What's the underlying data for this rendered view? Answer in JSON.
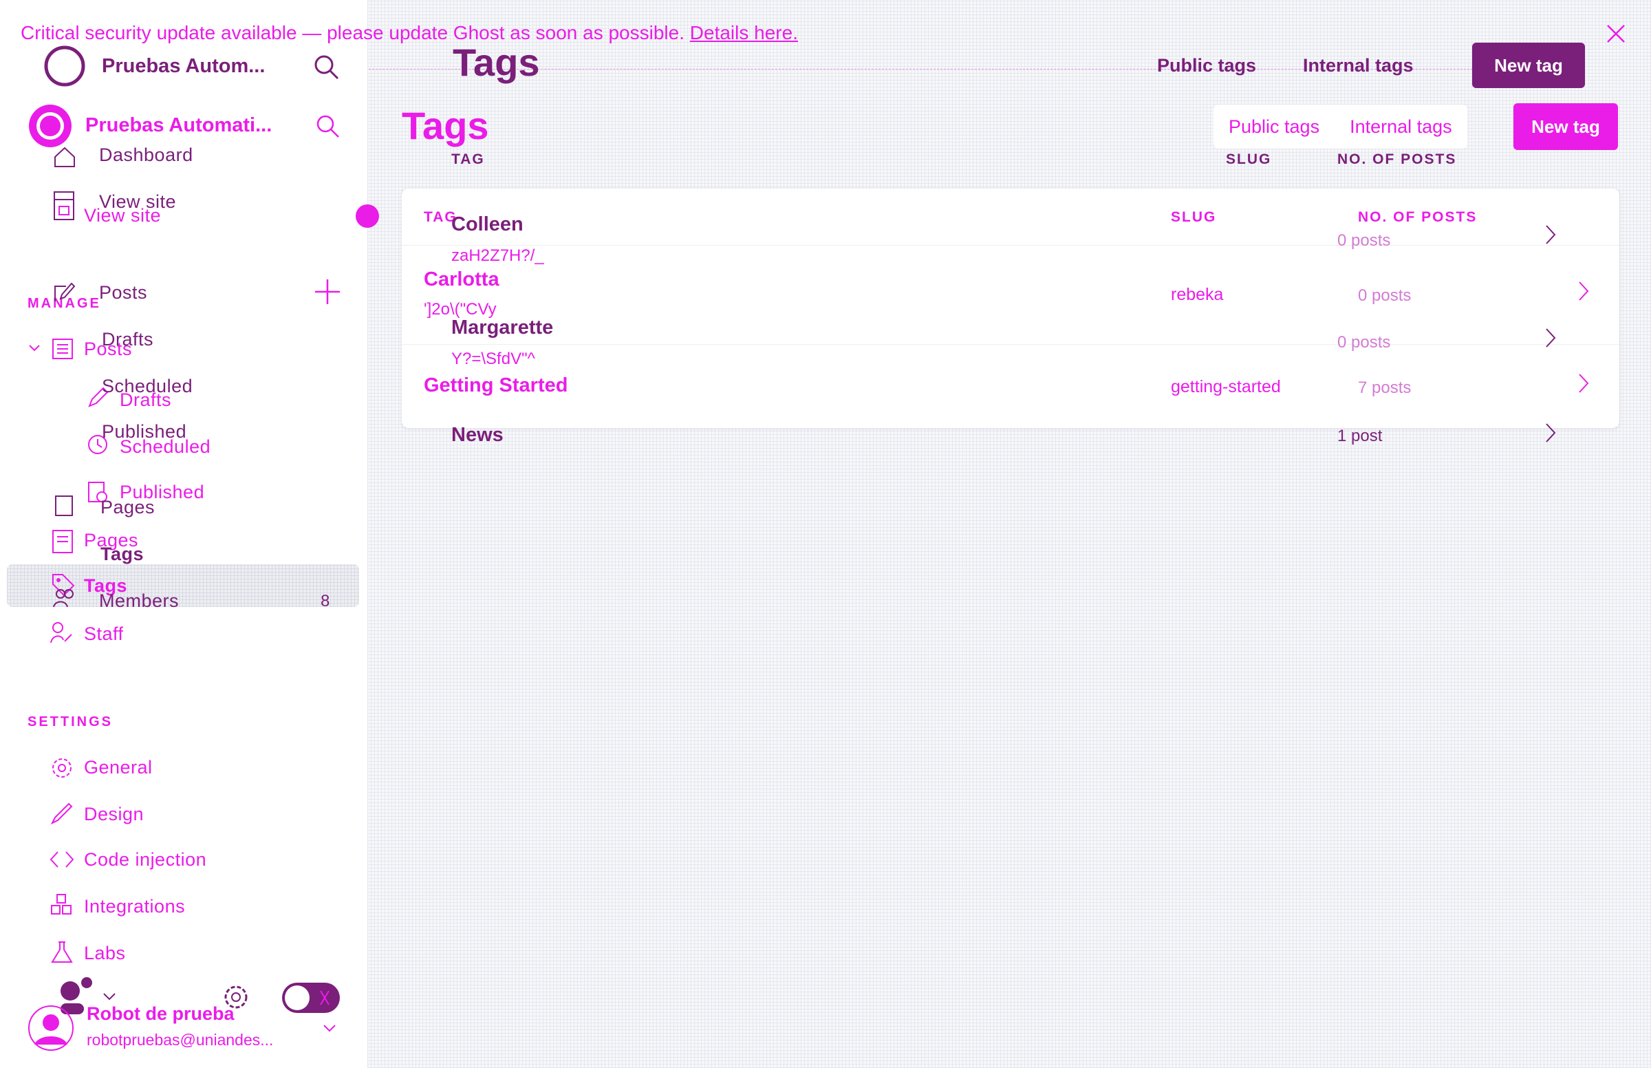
{
  "banner": {
    "text": "Critical security update available — please update Ghost as soon as possible.",
    "link": "Details here."
  },
  "site": {
    "name_short": "Pruebas Autom...",
    "name": "Pruebas Automati..."
  },
  "nav": {
    "dashboard": "Dashboard",
    "view_site": "View site",
    "manage_heading": "MANAGE",
    "posts": "Posts",
    "drafts": "Drafts",
    "scheduled": "Scheduled",
    "published": "Published",
    "pages": "Pages",
    "tags": "Tags",
    "members": "Members",
    "members_count": "8",
    "staff": "Staff",
    "settings_heading": "SETTINGS",
    "general": "General",
    "design": "Design",
    "code_injection": "Code injection",
    "integrations": "Integrations",
    "labs": "Labs"
  },
  "user": {
    "name": "Robot de prueba",
    "email": "robotpruebas@uniandes..."
  },
  "page": {
    "title": "Tags",
    "tab_public": "Public tags",
    "tab_internal": "Internal tags",
    "new_tag": "New tag"
  },
  "table": {
    "col_tag": "TAG",
    "col_slug": "SLUG",
    "col_posts": "NO. OF POSTS",
    "rows": [
      {
        "name": "Carlotta",
        "description": "']2o\\(\"CVy",
        "slug": "rebeka",
        "posts": "0 posts"
      },
      {
        "name": "Getting Started",
        "description": "",
        "slug": "getting-started",
        "posts": "7 posts"
      }
    ],
    "ghost_rows": [
      {
        "name": "Colleen",
        "description": "zaH2Z7H?/_",
        "posts": "0 posts"
      },
      {
        "name": "Margarette",
        "description": "Y?=\\SfdV\"^",
        "posts": "0 posts"
      },
      {
        "name": "News",
        "description": "",
        "posts": "1 post"
      }
    ]
  },
  "colors": {
    "accent": "#ea1ce8",
    "dark": "#7a1f7a",
    "background": "#f6f7f9"
  },
  "icons": [
    "search-icon",
    "home-icon",
    "view-site-icon",
    "posts-icon",
    "add-icon",
    "drafts-icon",
    "scheduled-icon",
    "published-icon",
    "pages-icon",
    "tags-icon",
    "members-icon",
    "staff-icon",
    "general-icon",
    "design-icon",
    "code-icon",
    "integrations-icon",
    "labs-icon",
    "settings-icon",
    "chevron-right-icon",
    "close-icon"
  ]
}
